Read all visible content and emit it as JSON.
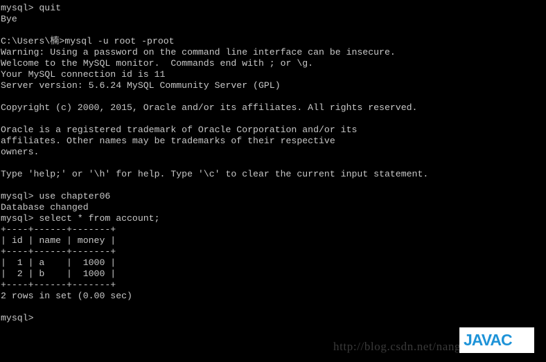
{
  "terminal": {
    "background_color": "#000000",
    "text_color": "#c8c8c8",
    "lines": [
      "mysql> quit",
      "Bye",
      "",
      "C:\\Users\\楠>mysql -u root -proot",
      "Warning: Using a password on the command line interface can be insecure.",
      "Welcome to the MySQL monitor.  Commands end with ; or \\g.",
      "Your MySQL connection id is 11",
      "Server version: 5.6.24 MySQL Community Server (GPL)",
      "",
      "Copyright (c) 2000, 2015, Oracle and/or its affiliates. All rights reserved.",
      "",
      "Oracle is a registered trademark of Oracle Corporation and/or its",
      "affiliates. Other names may be trademarks of their respective",
      "owners.",
      "",
      "Type 'help;' or '\\h' for help. Type '\\c' to clear the current input statement.",
      "",
      "mysql> use chapter06",
      "Database changed",
      "mysql> select * from account;",
      "+----+------+-------+",
      "| id | name | money |",
      "+----+------+-------+",
      "|  1 | a    |  1000 |",
      "|  2 | b    |  1000 |",
      "+----+------+-------+",
      "2 rows in set (0.00 sec)",
      "",
      "mysql>"
    ]
  },
  "query_result": {
    "columns": [
      "id",
      "name",
      "money"
    ],
    "rows": [
      {
        "id": "1",
        "name": "a",
        "money": "1000"
      },
      {
        "id": "2",
        "name": "b",
        "money": "1000"
      }
    ],
    "row_count_text": "2 rows in set (0.00 sec)"
  },
  "session": {
    "prompt": "mysql>",
    "commands": [
      "quit",
      "mysql -u root -proot",
      "use chapter06",
      "select * from account;"
    ],
    "database": "chapter06",
    "connection_id": "11",
    "server_version": "5.6.24 MySQL Community Server (GPL)",
    "windows_prompt": "C:\\Users\\楠>"
  },
  "watermark": {
    "url_text": "http://blog.csdn.net/nangeali",
    "url_color": "#3a3a3a",
    "logo_text": "JAVAC",
    "logo_color": "#1e93d8",
    "logo_background": "#ffffff"
  }
}
